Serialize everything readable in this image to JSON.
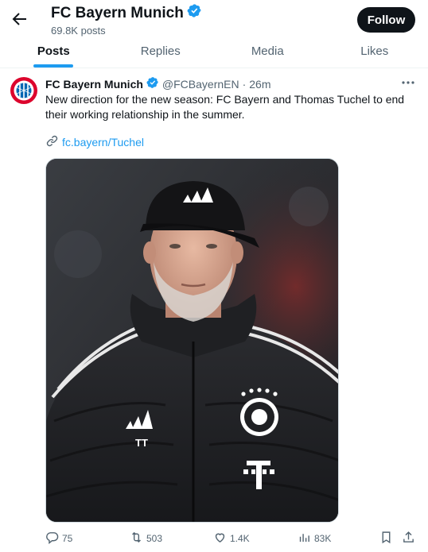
{
  "header": {
    "title": "FC Bayern Munich",
    "posts_count": "69.8K posts",
    "follow_label": "Follow"
  },
  "tabs": [
    {
      "label": "Posts",
      "active": true
    },
    {
      "label": "Replies",
      "active": false
    },
    {
      "label": "Media",
      "active": false
    },
    {
      "label": "Likes",
      "active": false
    }
  ],
  "tweet": {
    "author_name": "FC Bayern Munich",
    "handle": "@FCBayernEN",
    "separator": "·",
    "time": "26m",
    "text": "New direction for the new season: FC Bayern and Thomas Tuchel to end their working relationship in the summer.",
    "link": "fc.bayern/Tuchel",
    "media_alt": "Thomas Tuchel in black cap and padded jacket",
    "stats": {
      "replies": "75",
      "reposts": "503",
      "likes": "1.4K",
      "views": "83K"
    }
  },
  "colors": {
    "accent": "#1d9bf0",
    "verified": "#1d9bf0",
    "bayern_red": "#dc052d",
    "text_secondary": "#536471"
  },
  "icons": {
    "back": "arrow-left-icon",
    "verified": "verified-badge-icon",
    "more": "more-horizontal-icon",
    "link": "link-icon",
    "reply": "reply-icon",
    "repost": "repost-icon",
    "like": "heart-icon",
    "views": "views-chart-icon",
    "bookmark": "bookmark-icon",
    "share": "share-icon"
  }
}
